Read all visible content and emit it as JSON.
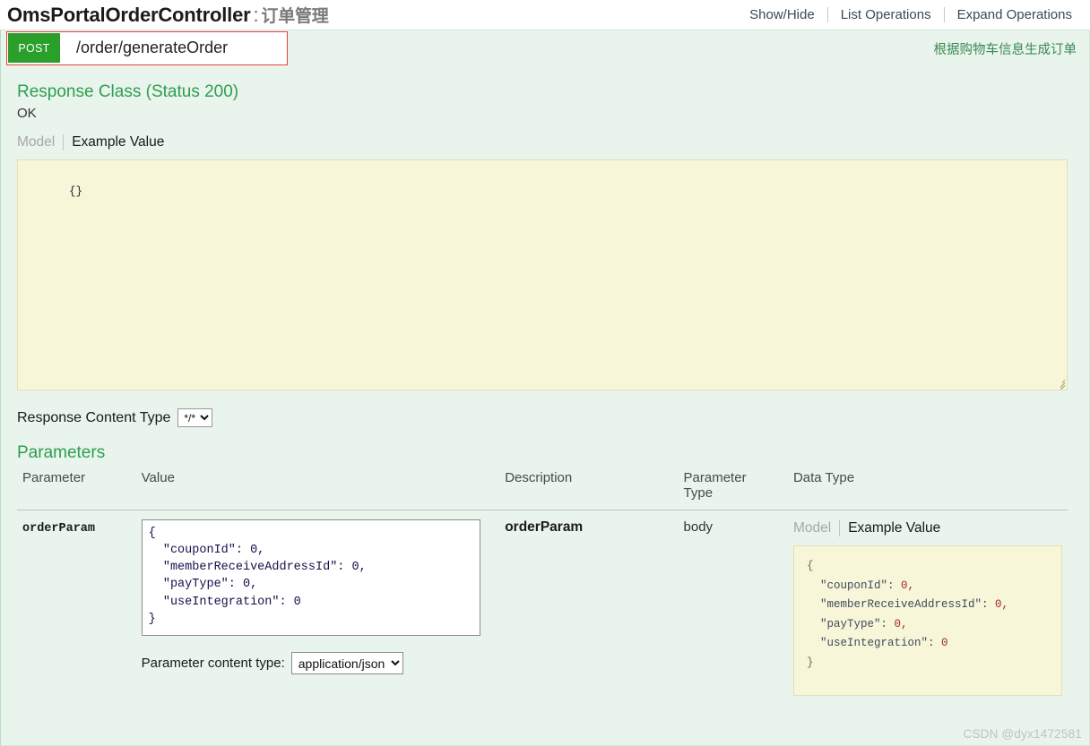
{
  "header": {
    "controller_name": "OmsPortalOrderController",
    "separator": ":",
    "controller_cn": "订单管理",
    "options": [
      {
        "label": "Show/Hide"
      },
      {
        "label": "List Operations"
      },
      {
        "label": "Expand Operations"
      }
    ]
  },
  "operation": {
    "method": "POST",
    "path": "/order/generateOrder",
    "summary_cn": "根据购物车信息生成订单"
  },
  "response_class": {
    "title": "Response Class (Status 200)",
    "status_text": "OK",
    "tabs": {
      "model": "Model",
      "example": "Example Value"
    },
    "example_body": "{}"
  },
  "response_content_type": {
    "label": "Response Content Type",
    "selected": "*/*",
    "options": [
      "*/*"
    ]
  },
  "parameters_section": {
    "title": "Parameters",
    "columns": {
      "parameter": "Parameter",
      "value": "Value",
      "description": "Description",
      "parameter_type": "Parameter\nType",
      "parameter_type_line1": "Parameter",
      "parameter_type_line2": "Type",
      "data_type": "Data Type"
    },
    "rows": [
      {
        "name": "orderParam",
        "value": "{\n  \"couponId\": 0,\n  \"memberReceiveAddressId\": 0,\n  \"payType\": 0,\n  \"useIntegration\": 0\n}",
        "description": "orderParam",
        "parameter_type": "body",
        "data_type": {
          "tabs": {
            "model": "Model",
            "example": "Example Value"
          },
          "example_lines": [
            {
              "punc": "{",
              "key": "",
              "num": ""
            },
            {
              "punc": "",
              "key": "\"couponId\":",
              "num": " 0,"
            },
            {
              "punc": "",
              "key": "\"memberReceiveAddressId\":",
              "num": " 0,"
            },
            {
              "punc": "",
              "key": "\"payType\":",
              "num": " 0,"
            },
            {
              "punc": "",
              "key": "\"useIntegration\":",
              "num": " 0"
            },
            {
              "punc": "}",
              "key": "",
              "num": ""
            }
          ]
        }
      }
    ],
    "content_type": {
      "label": "Parameter content type:",
      "selected": "application/json",
      "options": [
        "application/json"
      ]
    }
  },
  "watermark": "CSDN @dyx1472581",
  "colors": {
    "method_post": "#2aa02a",
    "panel_bg": "#e8f4ec",
    "code_bg": "#f8f6d9",
    "accent_green": "#2f9e4f",
    "annotation_red": "#e8423a"
  }
}
